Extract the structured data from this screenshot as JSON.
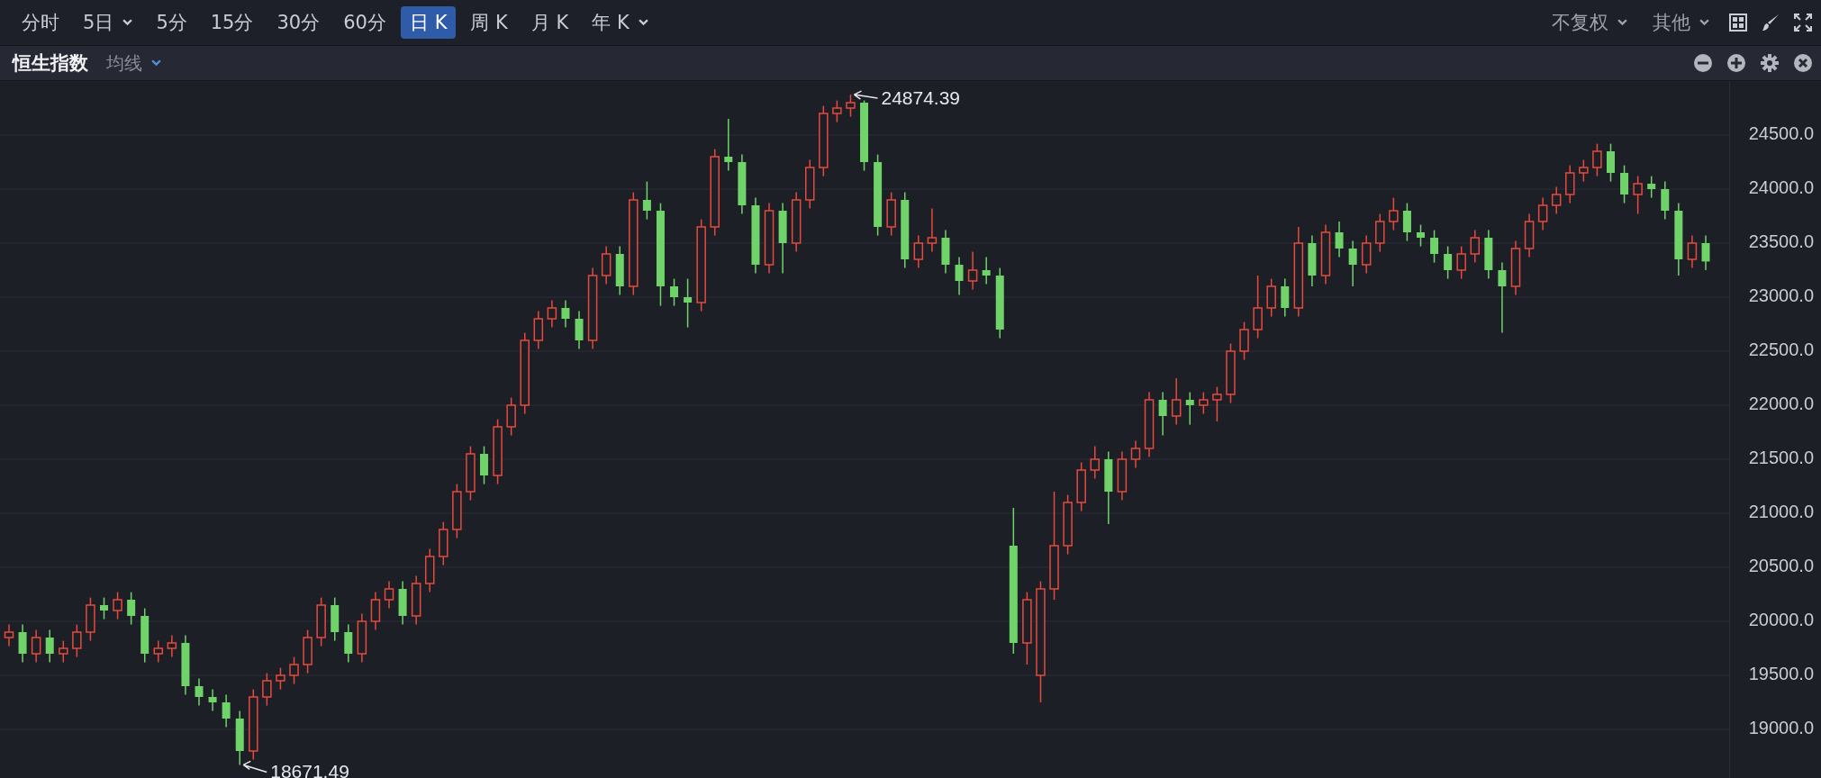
{
  "toolbar": {
    "periods": [
      {
        "label": "分时",
        "selected": false,
        "dropdown": false
      },
      {
        "label": "5日",
        "selected": false,
        "dropdown": true
      },
      {
        "label": "5分",
        "selected": false,
        "dropdown": false
      },
      {
        "label": "15分",
        "selected": false,
        "dropdown": false
      },
      {
        "label": "30分",
        "selected": false,
        "dropdown": false
      },
      {
        "label": "60分",
        "selected": false,
        "dropdown": false
      },
      {
        "label": "日 K",
        "selected": true,
        "dropdown": false
      },
      {
        "label": "周 K",
        "selected": false,
        "dropdown": false
      },
      {
        "label": "月 K",
        "selected": false,
        "dropdown": false
      },
      {
        "label": "年 K",
        "selected": false,
        "dropdown": true
      }
    ],
    "menus": [
      {
        "label": "不复权"
      },
      {
        "label": "其他"
      }
    ]
  },
  "chart_header": {
    "title": "恒生指数",
    "indicator": "均线"
  },
  "chart": {
    "chart_data": {
      "type": "candlestick",
      "grid": true,
      "ohlc": [
        [
          19850,
          19970,
          19770,
          19900
        ],
        [
          19900,
          19970,
          19620,
          19700
        ],
        [
          19700,
          19920,
          19620,
          19850
        ],
        [
          19850,
          19920,
          19620,
          19700
        ],
        [
          19700,
          19820,
          19620,
          19750
        ],
        [
          19750,
          19970,
          19670,
          19900
        ],
        [
          19900,
          20220,
          19820,
          20150
        ],
        [
          20150,
          20220,
          20020,
          20100
        ],
        [
          20100,
          20270,
          20020,
          20200
        ],
        [
          20200,
          20270,
          19970,
          20050
        ],
        [
          20050,
          20120,
          19620,
          19700
        ],
        [
          19700,
          19820,
          19620,
          19750
        ],
        [
          19750,
          19870,
          19670,
          19800
        ],
        [
          19800,
          19870,
          19320,
          19400
        ],
        [
          19400,
          19470,
          19220,
          19300
        ],
        [
          19300,
          19370,
          19170,
          19250
        ],
        [
          19250,
          19320,
          19020,
          19100
        ],
        [
          19100,
          19170,
          18671.49,
          18800
        ],
        [
          18800,
          19370,
          18720,
          19300
        ],
        [
          19300,
          19520,
          19220,
          19450
        ],
        [
          19450,
          19570,
          19370,
          19500
        ],
        [
          19500,
          19670,
          19420,
          19600
        ],
        [
          19600,
          19920,
          19520,
          19850
        ],
        [
          19850,
          20220,
          19770,
          20150
        ],
        [
          20150,
          20220,
          19820,
          19900
        ],
        [
          19900,
          19970,
          19620,
          19700
        ],
        [
          19700,
          20070,
          19620,
          20000
        ],
        [
          20000,
          20270,
          19920,
          20200
        ],
        [
          20200,
          20370,
          20120,
          20300
        ],
        [
          20300,
          20370,
          19970,
          20050
        ],
        [
          20050,
          20420,
          19970,
          20350
        ],
        [
          20350,
          20670,
          20270,
          20600
        ],
        [
          20600,
          20920,
          20520,
          20850
        ],
        [
          20850,
          21270,
          20770,
          21200
        ],
        [
          21200,
          21620,
          21120,
          21550
        ],
        [
          21550,
          21620,
          21270,
          21350
        ],
        [
          21350,
          21870,
          21270,
          21800
        ],
        [
          21800,
          22070,
          21720,
          22000
        ],
        [
          22000,
          22670,
          21920,
          22600
        ],
        [
          22600,
          22870,
          22520,
          22800
        ],
        [
          22800,
          22970,
          22720,
          22900
        ],
        [
          22900,
          22970,
          22720,
          22800
        ],
        [
          22800,
          22870,
          22520,
          22600
        ],
        [
          22600,
          23270,
          22520,
          23200
        ],
        [
          23200,
          23470,
          23120,
          23400
        ],
        [
          23400,
          23470,
          23020,
          23100
        ],
        [
          23100,
          23970,
          23020,
          23900
        ],
        [
          23900,
          24070,
          23720,
          23800
        ],
        [
          23800,
          23870,
          22920,
          23100
        ],
        [
          23100,
          23170,
          22920,
          23000
        ],
        [
          23000,
          23170,
          22720,
          22950
        ],
        [
          22950,
          23720,
          22870,
          23650
        ],
        [
          23650,
          24370,
          23570,
          24300
        ],
        [
          24300,
          24650,
          24170,
          24250
        ],
        [
          24250,
          24320,
          23770,
          23850
        ],
        [
          23850,
          23920,
          23220,
          23300
        ],
        [
          23300,
          23870,
          23220,
          23800
        ],
        [
          23800,
          23870,
          23220,
          23500
        ],
        [
          23500,
          23970,
          23420,
          23900
        ],
        [
          23900,
          24270,
          23820,
          24200
        ],
        [
          24200,
          24770,
          24120,
          24700
        ],
        [
          24700,
          24820,
          24620,
          24750
        ],
        [
          24750,
          24874.39,
          24670,
          24800
        ],
        [
          24800,
          24820,
          24170,
          24250
        ],
        [
          24250,
          24320,
          23570,
          23650
        ],
        [
          23650,
          23970,
          23570,
          23900
        ],
        [
          23900,
          23970,
          23270,
          23350
        ],
        [
          23350,
          23570,
          23270,
          23500
        ],
        [
          23500,
          23820,
          23420,
          23550
        ],
        [
          23550,
          23620,
          23220,
          23300
        ],
        [
          23300,
          23370,
          23020,
          23150
        ],
        [
          23150,
          23420,
          23070,
          23250
        ],
        [
          23250,
          23370,
          23120,
          23200
        ],
        [
          23200,
          23270,
          22620,
          22700
        ],
        [
          20700,
          21050,
          19700,
          19800
        ],
        [
          19800,
          20270,
          19600,
          20200
        ],
        [
          19500,
          20370,
          19250,
          20300
        ],
        [
          20300,
          21200,
          20200,
          20700
        ],
        [
          20700,
          21170,
          20620,
          21100
        ],
        [
          21100,
          21470,
          21020,
          21400
        ],
        [
          21400,
          21620,
          21320,
          21500
        ],
        [
          21500,
          21570,
          20900,
          21200
        ],
        [
          21200,
          21570,
          21120,
          21500
        ],
        [
          21500,
          21670,
          21420,
          21600
        ],
        [
          21600,
          22120,
          21520,
          22050
        ],
        [
          22050,
          22120,
          21720,
          21900
        ],
        [
          21900,
          22250,
          21820,
          22050
        ],
        [
          22050,
          22120,
          21820,
          22000
        ],
        [
          22000,
          22120,
          21920,
          22050
        ],
        [
          22050,
          22170,
          21850,
          22100
        ],
        [
          22100,
          22570,
          22020,
          22500
        ],
        [
          22500,
          22770,
          22420,
          22700
        ],
        [
          22700,
          23200,
          22620,
          22900
        ],
        [
          22900,
          23170,
          22820,
          23100
        ],
        [
          23100,
          23170,
          22820,
          22900
        ],
        [
          22900,
          23650,
          22820,
          23500
        ],
        [
          23500,
          23570,
          23100,
          23200
        ],
        [
          23200,
          23670,
          23120,
          23600
        ],
        [
          23600,
          23700,
          23370,
          23450
        ],
        [
          23450,
          23520,
          23100,
          23300
        ],
        [
          23300,
          23570,
          23220,
          23500
        ],
        [
          23500,
          23770,
          23420,
          23700
        ],
        [
          23700,
          23920,
          23620,
          23800
        ],
        [
          23800,
          23870,
          23520,
          23600
        ],
        [
          23600,
          23670,
          23470,
          23550
        ],
        [
          23550,
          23620,
          23320,
          23400
        ],
        [
          23400,
          23470,
          23170,
          23250
        ],
        [
          23250,
          23470,
          23170,
          23400
        ],
        [
          23400,
          23620,
          23320,
          23550
        ],
        [
          23550,
          23620,
          23170,
          23250
        ],
        [
          23250,
          23320,
          22670,
          23100
        ],
        [
          23100,
          23520,
          23020,
          23450
        ],
        [
          23450,
          23770,
          23370,
          23700
        ],
        [
          23700,
          23920,
          23620,
          23850
        ],
        [
          23850,
          24020,
          23770,
          23950
        ],
        [
          23950,
          24220,
          23870,
          24150
        ],
        [
          24150,
          24270,
          24070,
          24200
        ],
        [
          24200,
          24420,
          24120,
          24350
        ],
        [
          24350,
          24420,
          24070,
          24150
        ],
        [
          24150,
          24220,
          23870,
          23950
        ],
        [
          23950,
          24120,
          23770,
          24050
        ],
        [
          24050,
          24120,
          23920,
          24000
        ],
        [
          24000,
          24070,
          23720,
          23800
        ],
        [
          23800,
          23870,
          23200,
          23350
        ],
        [
          23350,
          23570,
          23270,
          23500
        ],
        [
          23500,
          23570,
          23250,
          23330
        ]
      ],
      "ylim": [
        18550,
        25000
      ],
      "yticks": [
        {
          "value": 24500,
          "label": "24500.0"
        },
        {
          "value": 24000,
          "label": "24000.0"
        },
        {
          "value": 23500,
          "label": "23500.0"
        },
        {
          "value": 23000,
          "label": "23000.0"
        },
        {
          "value": 22500,
          "label": "22500.0"
        },
        {
          "value": 22000,
          "label": "22000.0"
        },
        {
          "value": 21500,
          "label": "21500.0"
        },
        {
          "value": 21000,
          "label": "21000.0"
        },
        {
          "value": 20500,
          "label": "20500.0"
        },
        {
          "value": 20000,
          "label": "20000.0"
        },
        {
          "value": 19500,
          "label": "19500.0"
        },
        {
          "value": 19000,
          "label": "19000.0"
        }
      ],
      "annotations": [
        "24874.39",
        "18671.49"
      ]
    }
  }
}
